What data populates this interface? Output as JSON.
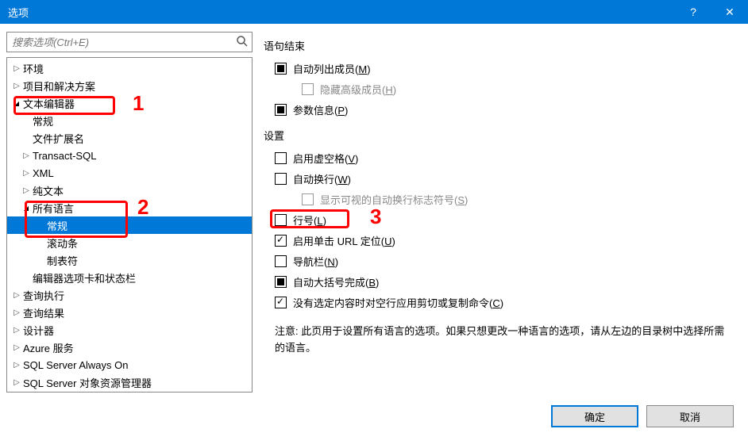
{
  "titlebar": {
    "title": "选项",
    "help": "?",
    "close": "✕"
  },
  "search": {
    "placeholder": "搜索选项(Ctrl+E)"
  },
  "tree": {
    "items": [
      {
        "label": "环境",
        "level": 0,
        "caret": "right"
      },
      {
        "label": "项目和解决方案",
        "level": 0,
        "caret": "right"
      },
      {
        "label": "文本编辑器",
        "level": 0,
        "caret": "down"
      },
      {
        "label": "常规",
        "level": 1,
        "caret": "none"
      },
      {
        "label": "文件扩展名",
        "level": 1,
        "caret": "none"
      },
      {
        "label": "Transact-SQL",
        "level": 1,
        "caret": "right"
      },
      {
        "label": "XML",
        "level": 1,
        "caret": "right"
      },
      {
        "label": "纯文本",
        "level": 1,
        "caret": "right"
      },
      {
        "label": "所有语言",
        "level": 1,
        "caret": "down"
      },
      {
        "label": "常规",
        "level": 2,
        "caret": "none",
        "selected": true
      },
      {
        "label": "滚动条",
        "level": 2,
        "caret": "none"
      },
      {
        "label": "制表符",
        "level": 2,
        "caret": "none"
      },
      {
        "label": "编辑器选项卡和状态栏",
        "level": 1,
        "caret": "none"
      },
      {
        "label": "查询执行",
        "level": 0,
        "caret": "right"
      },
      {
        "label": "查询结果",
        "level": 0,
        "caret": "right"
      },
      {
        "label": "设计器",
        "level": 0,
        "caret": "right"
      },
      {
        "label": "Azure 服务",
        "level": 0,
        "caret": "right"
      },
      {
        "label": "SQL Server Always On",
        "level": 0,
        "caret": "right"
      },
      {
        "label": "SQL Server 对象资源管理器",
        "level": 0,
        "caret": "right"
      }
    ]
  },
  "right": {
    "sec1": "语句结束",
    "sec2": "设置",
    "cb_auto_list": "自动列出成员(M)",
    "cb_hide_adv": "隐藏高级成员(H)",
    "cb_param": "参数信息(P)",
    "cb_virtual": "启用虚空格(V)",
    "cb_wrap": "自动换行(W)",
    "cb_wrap_glyph": "显示可视的自动换行标志符号(S)",
    "cb_lineno": "行号(L)",
    "cb_url": "启用单击 URL 定位(U)",
    "cb_nav": "导航栏(N)",
    "cb_brace": "自动大括号完成(B)",
    "cb_cutcopy": "没有选定内容时对空行应用剪切或复制命令(C)",
    "note": "注意: 此页用于设置所有语言的选项。如果只想更改一种语言的选项，请从左边的目录树中选择所需的语言。"
  },
  "buttons": {
    "ok": "确定",
    "cancel": "取消"
  },
  "annotations": {
    "a1": "1",
    "a2": "2",
    "a3": "3"
  }
}
